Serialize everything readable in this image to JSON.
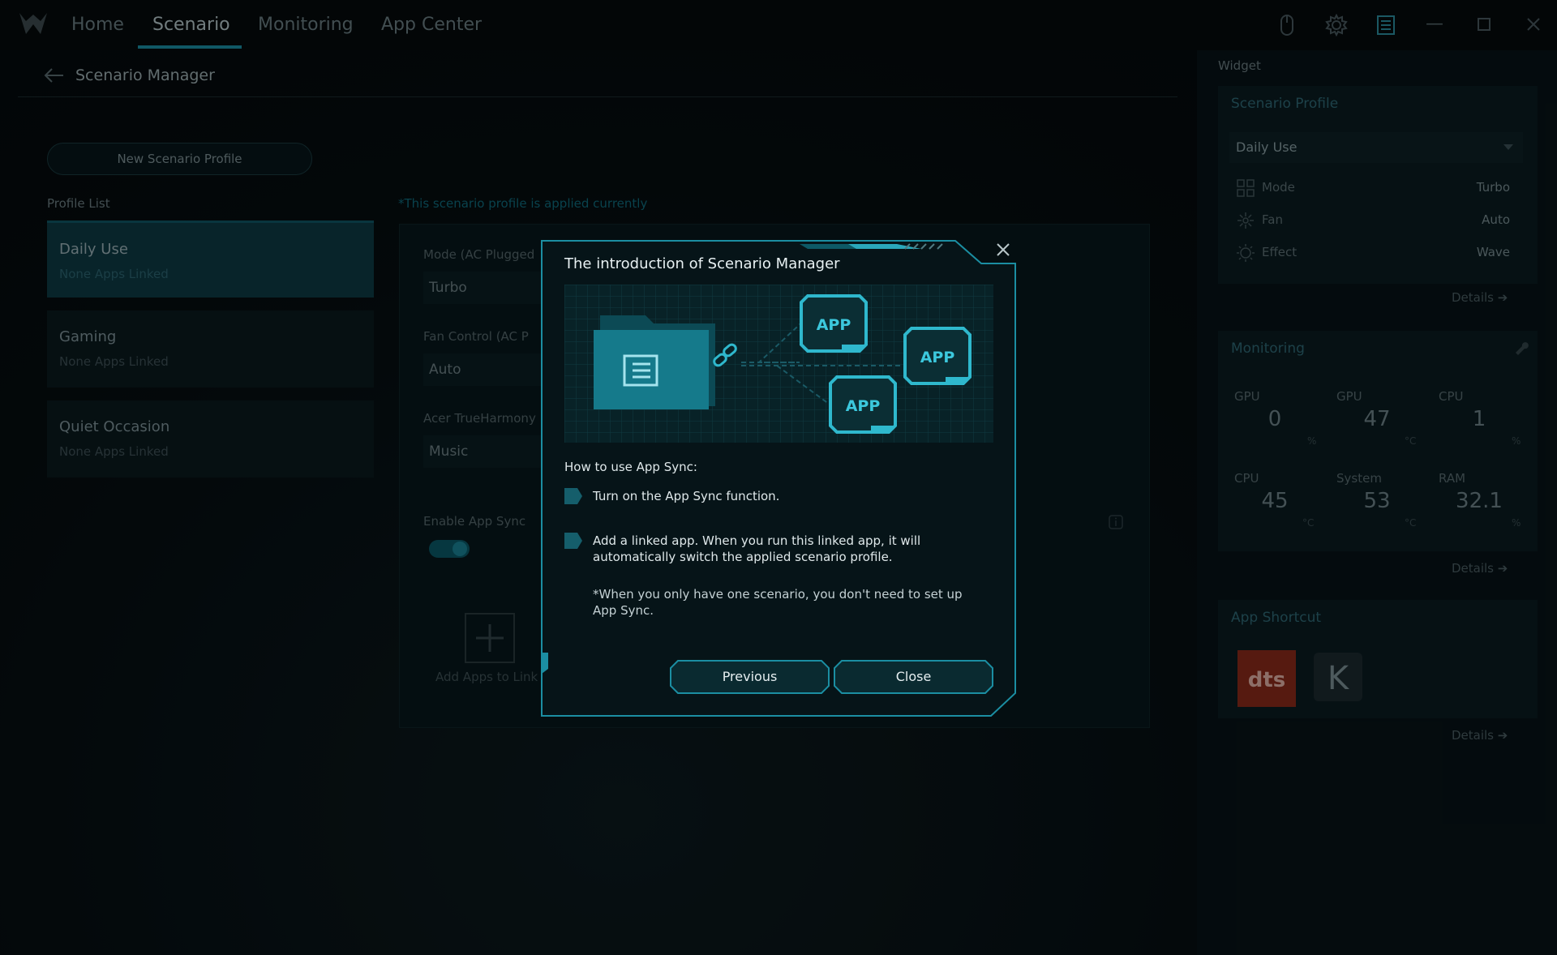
{
  "nav": {
    "tabs": [
      "Home",
      "Scenario",
      "Monitoring",
      "App Center"
    ],
    "active_tab": "Scenario"
  },
  "page": {
    "title": "Scenario Manager",
    "new_profile_button": "New Scenario Profile",
    "profile_list_label": "Profile List",
    "profiles": [
      {
        "name": "Daily Use",
        "sub": "None Apps Linked",
        "active": true
      },
      {
        "name": "Gaming",
        "sub": "None Apps Linked",
        "active": false
      },
      {
        "name": "Quiet Occasion",
        "sub": "None Apps Linked",
        "active": false
      }
    ],
    "applied_note": "*This scenario profile is applied currently",
    "settings": {
      "mode_label": "Mode (AC Plugged",
      "mode_value": "Turbo",
      "fan_label": "Fan Control (AC P",
      "fan_value": "Auto",
      "harmony_label": "Acer TrueHarmony",
      "harmony_value": "Music",
      "appsync_label": "Enable App Sync",
      "add_apps_label": "Add Apps to Link"
    }
  },
  "widget": {
    "title": "Widget",
    "scenario": {
      "head": "Scenario Profile",
      "selected": "Daily Use",
      "rows": [
        {
          "label": "Mode",
          "value": "Turbo",
          "icon": "grid-icon"
        },
        {
          "label": "Fan",
          "value": "Auto",
          "icon": "fan-icon"
        },
        {
          "label": "Effect",
          "value": "Wave",
          "icon": "sun-icon"
        }
      ],
      "details": "Details"
    },
    "monitoring": {
      "head": "Monitoring",
      "stats": [
        {
          "label": "GPU",
          "value": "0",
          "unit": "%"
        },
        {
          "label": "GPU",
          "value": "47",
          "unit": "°C"
        },
        {
          "label": "CPU",
          "value": "1",
          "unit": "%"
        },
        {
          "label": "CPU",
          "value": "45",
          "unit": "°C"
        },
        {
          "label": "System",
          "value": "53",
          "unit": "°C"
        },
        {
          "label": "RAM",
          "value": "32.1",
          "unit": "%"
        }
      ],
      "details": "Details"
    },
    "shortcut": {
      "head": "App Shortcut",
      "apps": [
        {
          "name": "dts",
          "color": "#c8331d"
        },
        {
          "name": "K",
          "color": "#2a3a40"
        }
      ],
      "details": "Details"
    }
  },
  "modal": {
    "title": "The introduction of Scenario Manager",
    "illustration_labels": [
      "APP",
      "APP",
      "APP"
    ],
    "howto": "How to use App Sync:",
    "steps": [
      "Turn on the App Sync function.",
      "Add a linked app. When you run this linked app, it will automatically switch the applied scenario profile."
    ],
    "note": "*When you only have one scenario, you don't need to set up App Sync.",
    "previous_button": "Previous",
    "close_button": "Close"
  },
  "colors": {
    "accent": "#1a9bb0",
    "modal_bg": "#061418",
    "modal_border": "#1b8ea2"
  }
}
